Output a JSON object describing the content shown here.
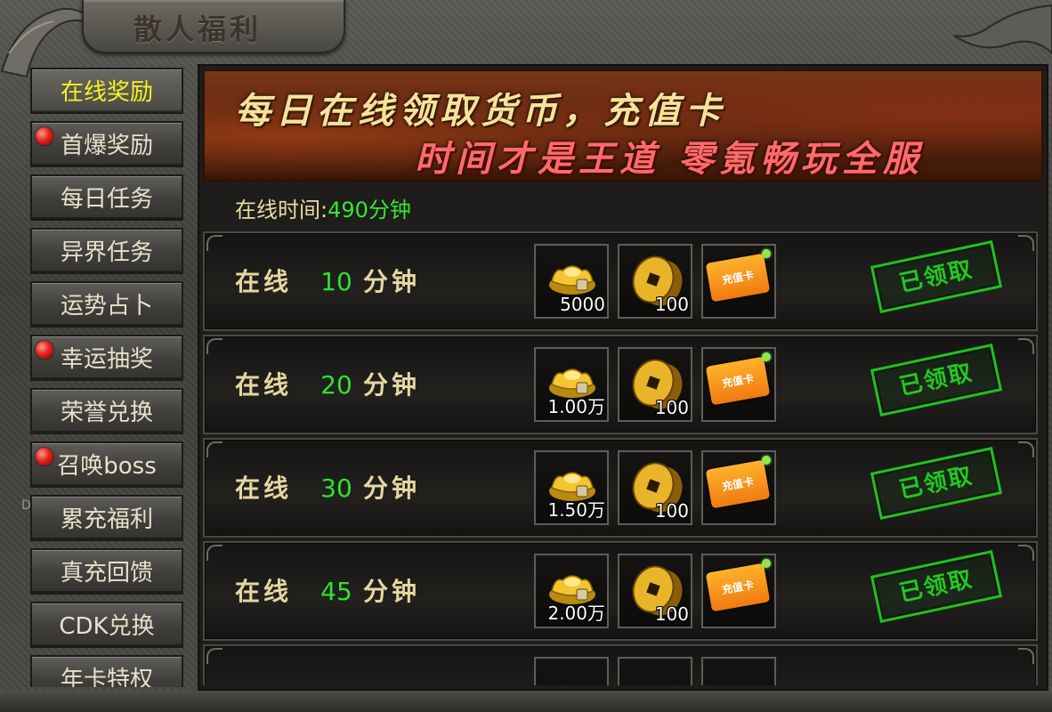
{
  "window": {
    "title": "散人福利"
  },
  "sidebar": {
    "items": [
      {
        "label": "在线奖励",
        "active": true,
        "badge": false
      },
      {
        "label": "首爆奖励",
        "active": false,
        "badge": true
      },
      {
        "label": "每日任务",
        "active": false,
        "badge": false
      },
      {
        "label": "异界任务",
        "active": false,
        "badge": false
      },
      {
        "label": "运势占卜",
        "active": false,
        "badge": false
      },
      {
        "label": "幸运抽奖",
        "active": false,
        "badge": true
      },
      {
        "label": "荣誉兑换",
        "active": false,
        "badge": false
      },
      {
        "label": "召唤boss",
        "active": false,
        "badge": true
      },
      {
        "label": "累充福利",
        "active": false,
        "badge": false
      },
      {
        "label": "真充回馈",
        "active": false,
        "badge": false
      },
      {
        "label": "CDK兑换",
        "active": false,
        "badge": false
      },
      {
        "label": "年卡特权",
        "active": false,
        "badge": false
      }
    ],
    "side_mark": "D"
  },
  "banner": {
    "line1": "每日在线领取货币，充值卡",
    "line2": "时间才是王道  零氪畅玩全服"
  },
  "online": {
    "label": "在线时间:",
    "value": "490分钟"
  },
  "rows": [
    {
      "prefix": "在线",
      "minutes": "10",
      "unit": "分钟",
      "gold_count": "5000",
      "coin_count": "100",
      "card_label": "充值卡",
      "status": "已领取"
    },
    {
      "prefix": "在线",
      "minutes": "20",
      "unit": "分钟",
      "gold_count": "1.00万",
      "coin_count": "100",
      "card_label": "充值卡",
      "status": "已领取"
    },
    {
      "prefix": "在线",
      "minutes": "30",
      "unit": "分钟",
      "gold_count": "1.50万",
      "coin_count": "100",
      "card_label": "充值卡",
      "status": "已领取"
    },
    {
      "prefix": "在线",
      "minutes": "45",
      "unit": "分钟",
      "gold_count": "2.00万",
      "coin_count": "100",
      "card_label": "充值卡",
      "status": "已领取"
    }
  ],
  "colors": {
    "active_nav": "#f4f41e",
    "online_value": "#35e635",
    "minutes": "#2fe22f",
    "stamp": "#22c822",
    "banner_line1": "#f6e29a",
    "banner_line2": "#ff6a6a"
  },
  "icons": {
    "gold": "gold-ingot-icon",
    "coin": "copper-coin-icon",
    "card": "recharge-card-icon",
    "badge": "red-dot-badge-icon"
  }
}
